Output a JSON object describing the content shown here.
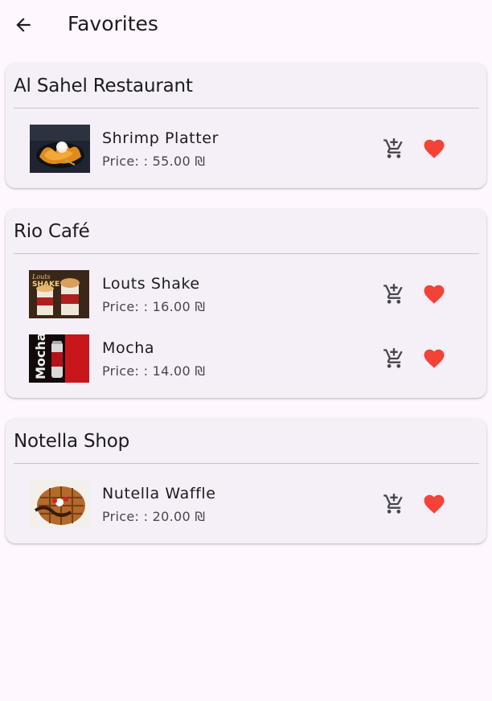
{
  "header": {
    "title": "Favorites",
    "back_icon": "arrow-back-icon"
  },
  "colors": {
    "background": "#fef7fd",
    "card": "#f5eff7",
    "favorite": "#f44336",
    "icon": "#49454f"
  },
  "restaurants": [
    {
      "name": "Al Sahel Restaurant",
      "items": [
        {
          "name": "Shrimp Platter",
          "price": "Price: : 55.00 ₪"
        }
      ]
    },
    {
      "name": "Rio Café",
      "items": [
        {
          "name": "Louts Shake",
          "price": "Price: : 16.00 ₪"
        },
        {
          "name": "Mocha",
          "price": "Price: : 14.00 ₪"
        }
      ]
    },
    {
      "name": "Notella Shop",
      "items": [
        {
          "name": "Nutella Waffle",
          "price": "Price: : 20.00 ₪"
        }
      ]
    }
  ],
  "icons": {
    "add_to_cart": "add-shopping-cart-icon",
    "favorite": "heart-icon"
  }
}
